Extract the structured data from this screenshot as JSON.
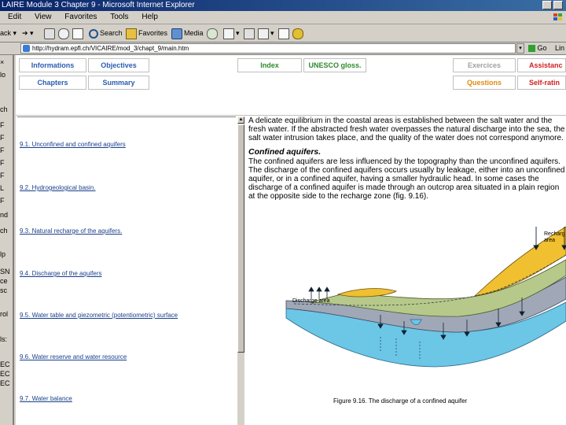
{
  "window": {
    "title": "LAIRE Module 3 Chapter 9 - Microsoft Internet Explorer"
  },
  "menu": [
    "Edit",
    "View",
    "Favorites",
    "Tools",
    "Help"
  ],
  "toolbar": {
    "back": "ack",
    "search": "Search",
    "favorites": "Favorites",
    "media": "Media"
  },
  "address": {
    "url": "http://hydram.epfl.ch/VICAIRE/mod_3/chapt_9/main.htm",
    "go_label": "Go",
    "links_label": "Lin"
  },
  "left_pane": {
    "top_labels": [
      "lo",
      "ch"
    ],
    "items": [
      "F",
      "F",
      "F",
      "F",
      "F",
      "L",
      "F",
      "nd",
      "ch",
      "lp",
      "SN",
      "ce",
      "sc",
      "rol",
      "ls:",
      "EC",
      "EC",
      "EC"
    ]
  },
  "nav": {
    "informations": "Informations",
    "objectives": "Objectives",
    "chapters": "Chapters",
    "summary": "Summary",
    "index": "Index",
    "unesco": "UNESCO gloss.",
    "exercices": "Exercices",
    "questions": "Questions",
    "assistance": "Assistanc",
    "self_rating": "Self-ratin"
  },
  "toc": [
    "9.1. Unconfined and confined aquifers",
    "9.2. Hydrogeological basin.",
    "9.3. Natural recharge of the aquifers.",
    "9.4. Discharge of the aquifers",
    "9.5. Water table and piezometric (potentiometric) surface",
    "9.6. Water reserve and water resource",
    "9.7. Water balance"
  ],
  "text": {
    "para1": "A delicate equilibrium in the coastal areas is established between the salt water and the fresh water. If the abstracted fresh water overpasses the natural discharge into the sea, the salt water intrusion takes place, and the quality of the water does not correspond anymore.",
    "heading": "Confined aquifers.",
    "para2": "The confined aquifers are less influenced by the topography than the unconfined aquifers. The discharge of the confined aquifers occurs usually by leakage, either into an unconfined aquifer, or in a confined aquifer, having a smaller hydraulic head. In some cases the discharge of a confined aquifer is made through an outcrop area situated in a plain region at the opposite side to the recharge zone (fig. 9.16)."
  },
  "figure": {
    "label_discharge": "Discharge area",
    "label_recharge_1": "Recharg",
    "label_recharge_2": "area",
    "caption": "Figure 9.16. The discharge of a confined aquifer",
    "colors": {
      "blue": "#6cc6e6",
      "yellow": "#f0c030",
      "green": "#b7c98a",
      "gray": "#a0a8b8"
    }
  }
}
